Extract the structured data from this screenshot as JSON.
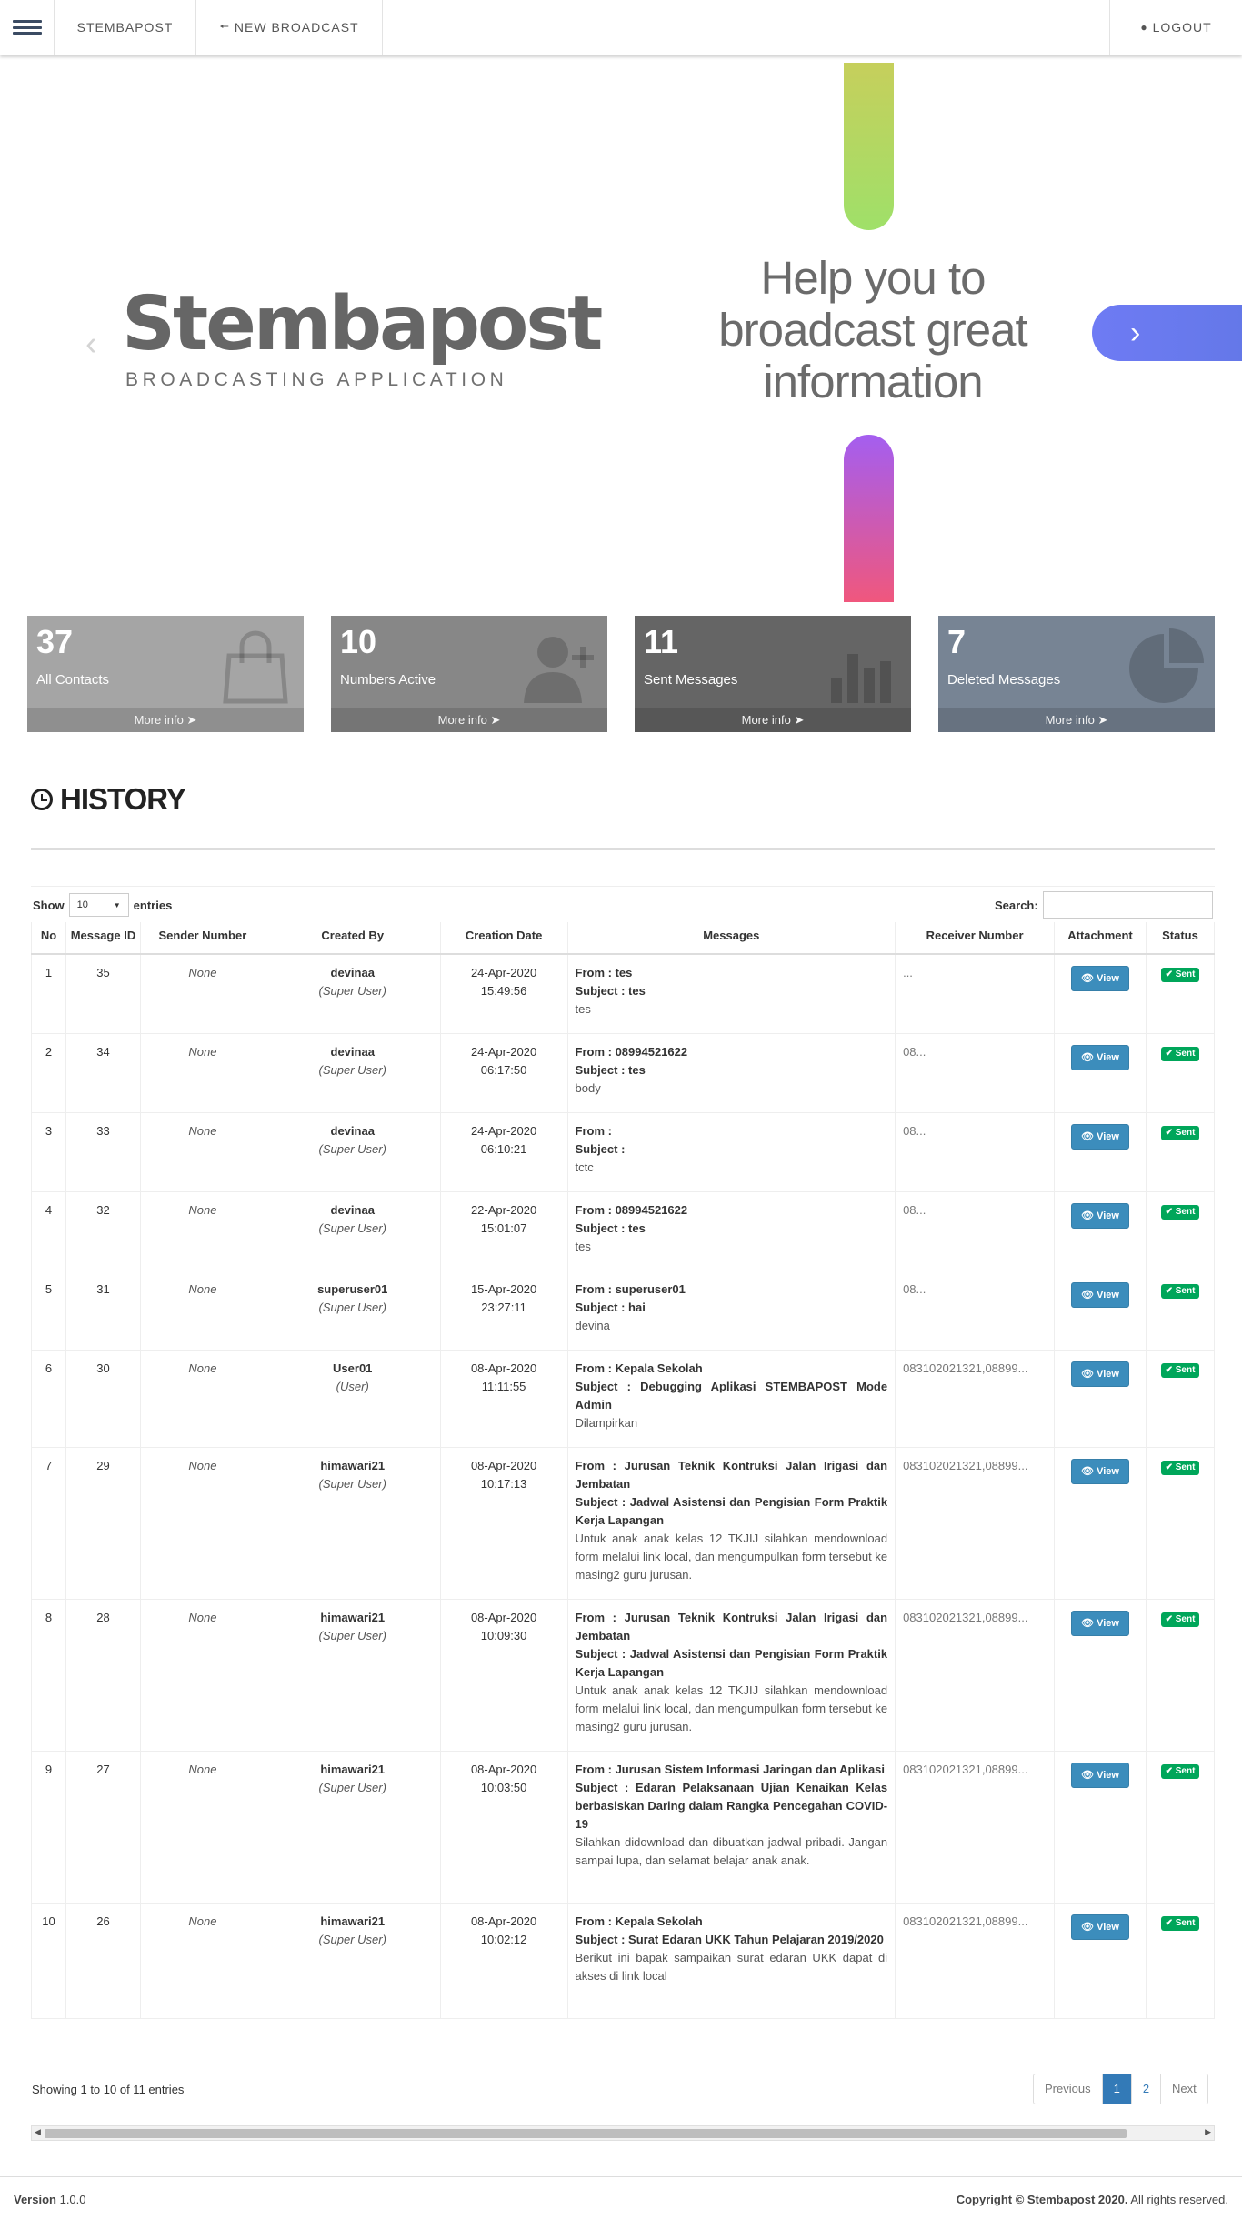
{
  "navbar": {
    "menu_icon": "hamburger-icon",
    "brand": "STEMBAPOST",
    "new_broadcast": "NEW BROADCAST",
    "logout": "LOGOUT"
  },
  "hero": {
    "logo_word": "Stembapost",
    "logo_tagline": "BROADCASTING APPLICATION",
    "tagline": "Help you to broadcast great information",
    "prev_icon": "chevron-left-icon",
    "next_icon": "chevron-right-icon"
  },
  "stats": [
    {
      "value": "37",
      "label": "All Contacts",
      "more": "More info",
      "color": "#a5a5a5",
      "icon": "shopping-bag-icon"
    },
    {
      "value": "10",
      "label": "Numbers Active",
      "more": "More info",
      "color": "#878787",
      "icon": "user-plus-icon"
    },
    {
      "value": "11",
      "label": "Sent Messages",
      "more": "More info",
      "color": "#656565",
      "icon": "bar-chart-icon"
    },
    {
      "value": "7",
      "label": "Deleted Messages",
      "more": "More info",
      "color": "#778494",
      "icon": "pie-chart-icon"
    }
  ],
  "history": {
    "title": "HISTORY",
    "show_label": "Show",
    "entries_value": "10",
    "entries_label": "entries",
    "search_label": "Search:",
    "columns": [
      "No",
      "Message ID",
      "Sender Number",
      "Created By",
      "Creation Date",
      "Messages",
      "Receiver Number",
      "Attachment",
      "Status"
    ],
    "view_label": "View",
    "sent_label": "Sent",
    "rows": [
      {
        "no": "1",
        "id": "35",
        "sender": "None",
        "user": "devinaa",
        "role": "(Super User)",
        "date": "24-Apr-2020",
        "time": "15:49:56",
        "from": "From : tes",
        "subject": "Subject : tes",
        "body": "tes",
        "receiver": "..."
      },
      {
        "no": "2",
        "id": "34",
        "sender": "None",
        "user": "devinaa",
        "role": "(Super User)",
        "date": "24-Apr-2020",
        "time": "06:17:50",
        "from": "From : 08994521622",
        "subject": "Subject : tes",
        "body": "body",
        "receiver": "08..."
      },
      {
        "no": "3",
        "id": "33",
        "sender": "None",
        "user": "devinaa",
        "role": "(Super User)",
        "date": "24-Apr-2020",
        "time": "06:10:21",
        "from": "From :",
        "subject": "Subject :",
        "body": "tctc",
        "receiver": "08..."
      },
      {
        "no": "4",
        "id": "32",
        "sender": "None",
        "user": "devinaa",
        "role": "(Super User)",
        "date": "22-Apr-2020",
        "time": "15:01:07",
        "from": "From : 08994521622",
        "subject": "Subject : tes",
        "body": "tes",
        "receiver": "08..."
      },
      {
        "no": "5",
        "id": "31",
        "sender": "None",
        "user": "superuser01",
        "role": "(Super User)",
        "date": "15-Apr-2020",
        "time": "23:27:11",
        "from": "From : superuser01",
        "subject": "Subject : hai",
        "body": "devina",
        "receiver": "08..."
      },
      {
        "no": "6",
        "id": "30",
        "sender": "None",
        "user": "User01",
        "role": "(User)",
        "date": "08-Apr-2020",
        "time": "11:11:55",
        "from": "From : Kepala Sekolah",
        "subject": "Subject : Debugging Aplikasi STEMBAPOST Mode Admin",
        "body": "Dilampirkan",
        "receiver": "083102021321,08899..."
      },
      {
        "no": "7",
        "id": "29",
        "sender": "None",
        "user": "himawari21",
        "role": "(Super User)",
        "date": "08-Apr-2020",
        "time": "10:17:13",
        "from": "From : Jurusan Teknik Kontruksi Jalan Irigasi dan Jembatan",
        "subject": "Subject : Jadwal Asistensi dan Pengisian Form Praktik Kerja Lapangan",
        "body": "Untuk anak anak kelas 12 TKJIJ silahkan mendownload form melalui link local, dan mengumpulkan form tersebut ke masing2 guru jurusan.",
        "receiver": "083102021321,08899..."
      },
      {
        "no": "8",
        "id": "28",
        "sender": "None",
        "user": "himawari21",
        "role": "(Super User)",
        "date": "08-Apr-2020",
        "time": "10:09:30",
        "from": "From : Jurusan Teknik Kontruksi Jalan Irigasi dan Jembatan",
        "subject": "Subject : Jadwal Asistensi dan Pengisian Form Praktik Kerja Lapangan",
        "body": "Untuk anak anak kelas 12 TKJIJ silahkan mendownload form melalui link local, dan mengumpulkan form tersebut ke masing2 guru jurusan.",
        "receiver": "083102021321,08899..."
      },
      {
        "no": "9",
        "id": "27",
        "sender": "None",
        "user": "himawari21",
        "role": "(Super User)",
        "date": "08-Apr-2020",
        "time": "10:03:50",
        "from": "From : Jurusan Sistem Informasi Jaringan dan Aplikasi",
        "subject": "Subject : Edaran Pelaksanaan Ujian Kenaikan Kelas berbasiskan Daring dalam Rangka Pencegahan COVID-19",
        "body": "Silahkan didownload dan dibuatkan jadwal pribadi. Jangan sampai lupa, dan selamat belajar anak anak.",
        "receiver": "083102021321,08899..."
      },
      {
        "no": "10",
        "id": "26",
        "sender": "None",
        "user": "himawari21",
        "role": "(Super User)",
        "date": "08-Apr-2020",
        "time": "10:02:12",
        "from": "From : Kepala Sekolah",
        "subject": "Subject : Surat Edaran UKK Tahun Pelajaran 2019/2020",
        "body": "Berikut ini bapak sampaikan surat edaran UKK dapat di akses di link local",
        "receiver": "083102021321,08899..."
      }
    ],
    "showing": "Showing 1 to 10 of 11 entries",
    "pagination": {
      "previous": "Previous",
      "page1": "1",
      "page2": "2",
      "next": "Next"
    }
  },
  "footer": {
    "version_label": "Version",
    "version": "1.0.0",
    "copyright_bold": "Copyright © Stembapost 2020.",
    "copyright_rest": "All rights reserved."
  }
}
